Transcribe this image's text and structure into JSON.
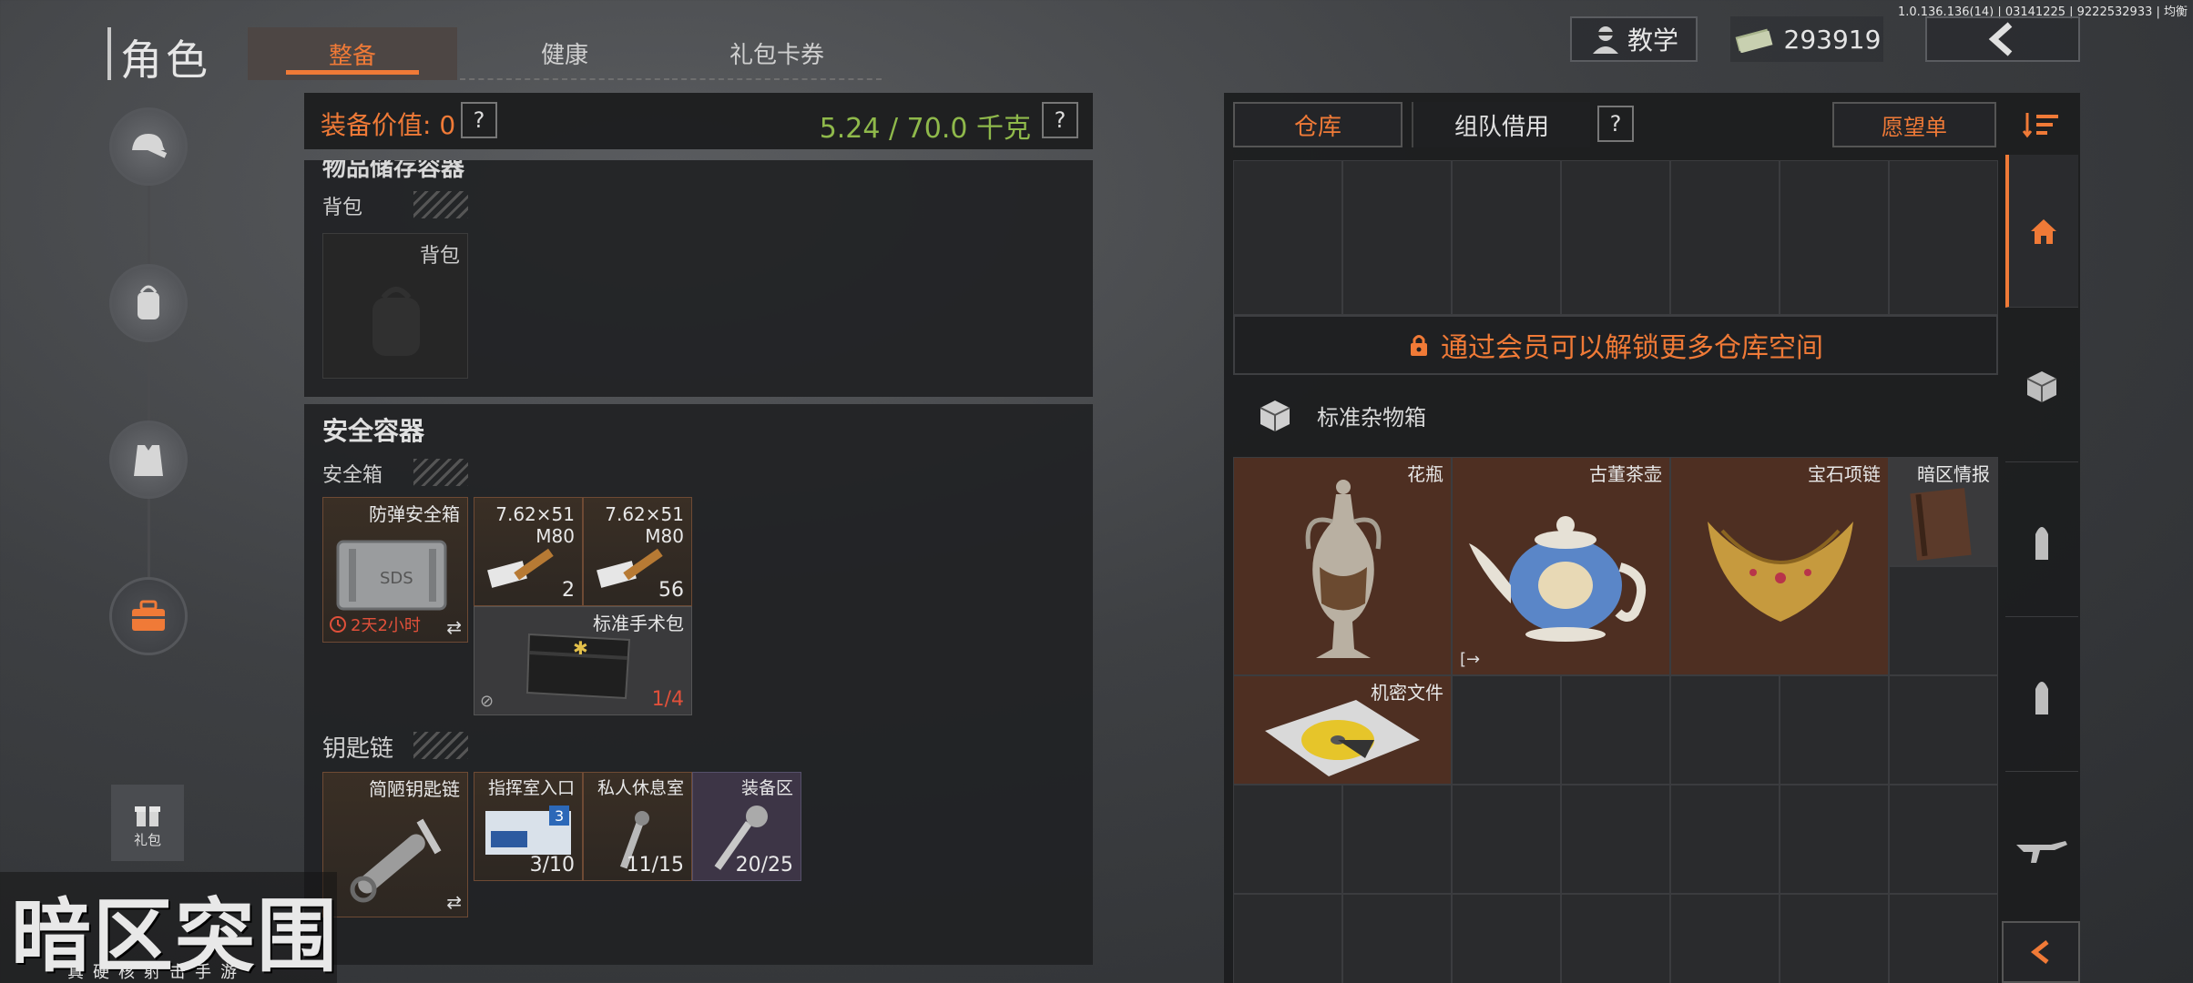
{
  "app": {
    "title": "角色",
    "version": "1.0.136.136(14) | 03141225 | 9222532933 | 均衡"
  },
  "tabs": [
    {
      "label": "整备",
      "active": true
    },
    {
      "label": "健康",
      "active": false
    },
    {
      "label": "礼包卡券",
      "active": false
    }
  ],
  "top": {
    "tutorial_label": "教学",
    "money": "293919",
    "back_icon": "chevron-left-icon"
  },
  "sidebar": {
    "items": [
      {
        "icon": "helmet-gun-icon"
      },
      {
        "icon": "backpack-icon"
      },
      {
        "icon": "tactical-vest-icon"
      },
      {
        "icon": "toolbox-icon",
        "active": true
      }
    ],
    "gift_label": "礼包"
  },
  "equip": {
    "value_label": "装备价值: 0",
    "weight": "5.24 / 70.0 千克",
    "help": "?",
    "storage_header": "物品储存容器",
    "backpack_section": "背包",
    "backpack_slot": "背包",
    "secure_header": "安全容器",
    "secure_section": "安全箱",
    "secure_items": [
      {
        "name": "防弹安全箱",
        "timer": "2天2小时"
      },
      {
        "name": "7.62×51\nM80",
        "count": "2"
      },
      {
        "name": "7.62×51\nM80",
        "count": "56"
      },
      {
        "name": "标准手术包",
        "count": "1/4"
      }
    ],
    "keychain_section": "钥匙链",
    "keychain_items": [
      {
        "name": "简陋钥匙链"
      },
      {
        "name": "指挥室入口",
        "count": "3/10"
      },
      {
        "name": "私人休息室",
        "count": "11/15"
      },
      {
        "name": "装备区",
        "count": "20/25"
      }
    ]
  },
  "warehouse": {
    "tab_storage": "仓库",
    "tab_team": "组队借用",
    "help": "?",
    "wishlist": "愿望单",
    "unlock_msg": "通过会员可以解锁更多仓库空间",
    "container_name": "标准杂物箱",
    "items": [
      {
        "name": "花瓶"
      },
      {
        "name": "古董茶壶"
      },
      {
        "name": "宝石项链"
      },
      {
        "name": "暗区情报"
      },
      {
        "name": "机密文件"
      }
    ]
  },
  "rightnav": [
    "home-icon",
    "crate-icon",
    "ammo-icon",
    "ammo-icon",
    "rifle-icon",
    "collapse-left-icon"
  ],
  "logo": {
    "title": "暗区突围",
    "subtitle": "真硬核射击手游"
  },
  "colors": {
    "accent": "#f07a37",
    "green": "#8fb94b",
    "item_brown": "#4e2f22"
  }
}
